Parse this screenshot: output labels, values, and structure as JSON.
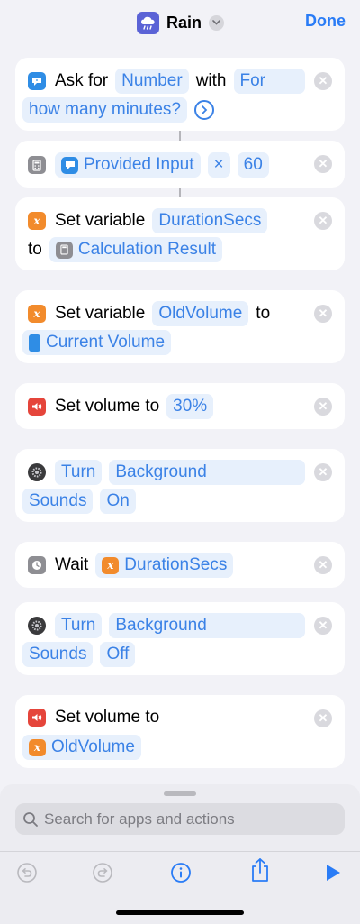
{
  "header": {
    "title": "Rain",
    "done_label": "Done",
    "icon": "rain-cloud-icon",
    "accent": "#2a7cf6"
  },
  "actions": [
    {
      "label": "Ask for",
      "token_type": "Number",
      "with": "with",
      "prompt_a": "For",
      "prompt_b": "how many minutes?"
    },
    {
      "input": "Provided Input",
      "operator": "×",
      "operand": "60"
    },
    {
      "label": "Set variable",
      "variable": "DurationSecs",
      "to": "to",
      "value": "Calculation Result"
    },
    {
      "label": "Set variable",
      "variable": "OldVolume",
      "to": "to",
      "value": "Current Volume"
    },
    {
      "label": "Set volume to",
      "value": "30%"
    },
    {
      "action": "Turn",
      "setting_a": "Background",
      "setting_b": "Sounds",
      "state": "On"
    },
    {
      "label": "Wait",
      "value": "DurationSecs"
    },
    {
      "action": "Turn",
      "setting_a": "Background",
      "setting_b": "Sounds",
      "state": "Off"
    },
    {
      "label": "Set volume to",
      "value": "OldVolume"
    }
  ],
  "search": {
    "placeholder": "Search for apps and actions"
  },
  "toolbar": {
    "undo_icon": "undo-icon",
    "redo_icon": "redo-icon",
    "info_icon": "info-icon",
    "share_icon": "share-icon",
    "play_icon": "play-icon"
  }
}
